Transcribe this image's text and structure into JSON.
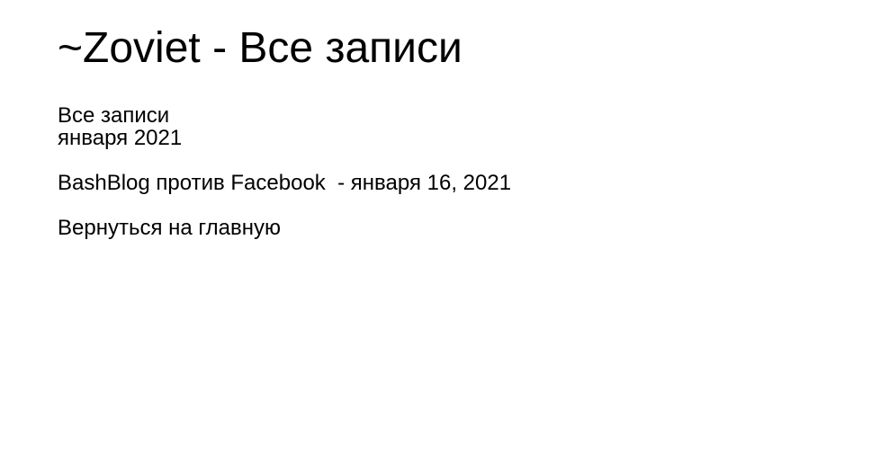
{
  "header": {
    "site_title": "~Zoviet - Все записи"
  },
  "archive": {
    "heading": "Все записи",
    "month": "января 2021",
    "posts": [
      {
        "title": "BashBlog против Facebook",
        "date_text": " - января 16, 2021"
      }
    ]
  },
  "footer": {
    "back_link": "Вернуться на главную"
  }
}
